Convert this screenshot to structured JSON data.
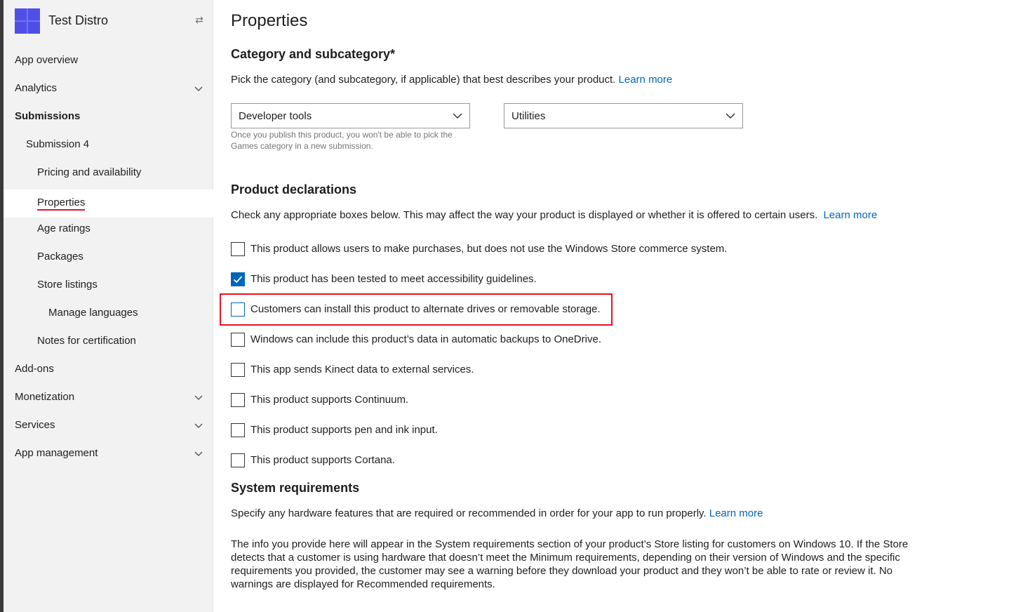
{
  "app": {
    "name": "Test Distro"
  },
  "sidebar": {
    "items": [
      {
        "label": "App overview",
        "expandable": false
      },
      {
        "label": "Analytics",
        "expandable": true
      },
      {
        "label": "Submissions",
        "expandable": false
      },
      {
        "label": "Submission 4",
        "expandable": false
      },
      {
        "label": "Pricing and availability",
        "expandable": false
      },
      {
        "label": "Properties",
        "expandable": false,
        "selected": true
      },
      {
        "label": "Age ratings",
        "expandable": false
      },
      {
        "label": "Packages",
        "expandable": false
      },
      {
        "label": "Store listings",
        "expandable": false
      },
      {
        "label": "Manage languages",
        "expandable": false
      },
      {
        "label": "Notes for certification",
        "expandable": false
      },
      {
        "label": "Add-ons",
        "expandable": false
      },
      {
        "label": "Monetization",
        "expandable": true
      },
      {
        "label": "Services",
        "expandable": true
      },
      {
        "label": "App management",
        "expandable": true
      }
    ]
  },
  "page": {
    "title": "Properties"
  },
  "category": {
    "heading": "Category and subcategory*",
    "description": "Pick the category (and subcategory, if applicable) that best describes your product.",
    "learn_more": "Learn more",
    "category_value": "Developer tools",
    "subcategory_value": "Utilities",
    "hint": "Once you publish this product, you won't be able to pick the Games category in a new submission."
  },
  "declarations": {
    "heading": "Product declarations",
    "description": "Check any appropriate boxes below. This may affect the way your product is displayed or whether it is offered to certain users.",
    "learn_more": "Learn more",
    "items": [
      {
        "label": "This product allows users to make purchases, but does not use the Windows Store commerce system.",
        "checked": false
      },
      {
        "label": "This product has been tested to meet accessibility guidelines.",
        "checked": true
      },
      {
        "label": "Customers can install this product to alternate drives or removable storage.",
        "checked": false,
        "highlighted": true
      },
      {
        "label": "Windows can include this product’s data in automatic backups to OneDrive.",
        "checked": false
      },
      {
        "label": "This app sends Kinect data to external services.",
        "checked": false
      },
      {
        "label": "This product supports Continuum.",
        "checked": false
      },
      {
        "label": "This product supports pen and ink input.",
        "checked": false
      },
      {
        "label": "This product supports Cortana.",
        "checked": false
      }
    ]
  },
  "system_requirements": {
    "heading": "System requirements",
    "description": "Specify any hardware features that are required or recommended in order for your app to run properly.",
    "learn_more": "Learn more",
    "info": "The info you provide here will appear in the System requirements section of your product’s Store listing for customers on Windows 10. If the Store detects that a customer is using hardware that doesn’t meet the Minimum requirements, depending on their version of Windows and the specific requirements you provided, the customer may see a warning before they download your product and they won’t be able to rate or review it. No warnings are displayed for Recommended requirements."
  },
  "colors": {
    "accent": "#0067b8",
    "highlight": "#e81123",
    "logo": "#4f4fe8",
    "sidebar_bg": "#f2f2f2"
  },
  "icons": {
    "expand": "chevron-down-icon",
    "collapse_nav": "collapse-nav-icon",
    "checkmark": "checkmark-icon"
  }
}
